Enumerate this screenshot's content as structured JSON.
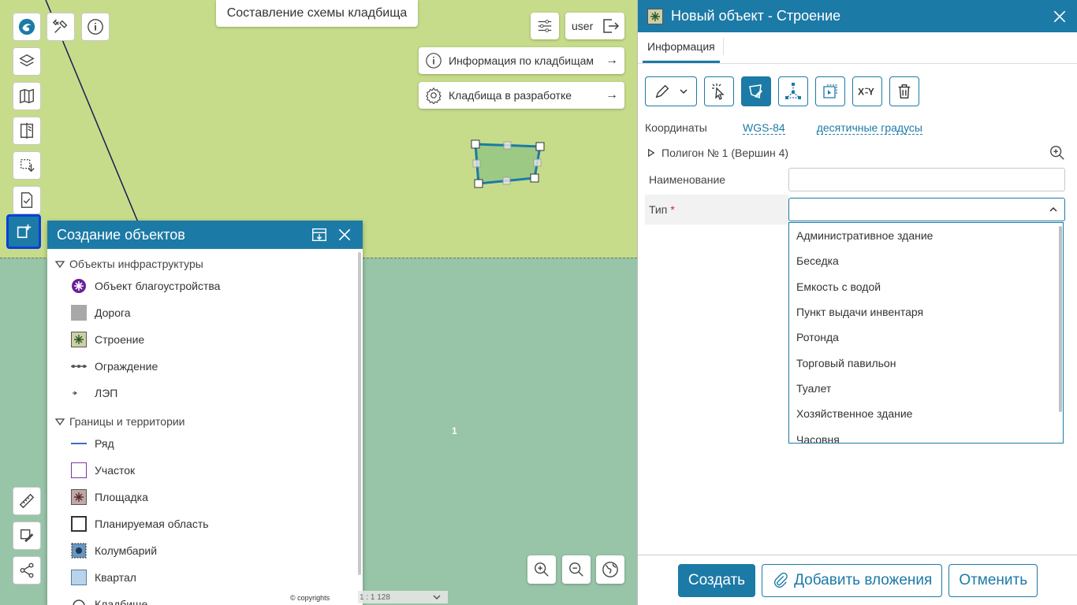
{
  "map": {
    "title": "Составление схемы кладбища",
    "polygon_label": "1",
    "user_label": "user",
    "info_buttons": [
      {
        "label": "Информация по кладбищам",
        "arrow": "→"
      },
      {
        "label": "Кладбища в разработке",
        "arrow": "→"
      }
    ],
    "copyright": "© copyrights",
    "scale": "1 : 1 128"
  },
  "create_panel": {
    "title": "Создание объектов",
    "groups": [
      {
        "label": "Объекты инфраструктуры",
        "items": [
          "Объект благоустройства",
          "Дорога",
          "Строение",
          "Ограждение",
          "ЛЭП"
        ]
      },
      {
        "label": "Границы и территории",
        "items": [
          "Ряд",
          "Участок",
          "Площадка",
          "Планируемая область",
          "Колумбарий",
          "Квартал",
          "Кладбище"
        ]
      }
    ]
  },
  "object_panel": {
    "title": "Новый объект - Строение",
    "tab": "Информация",
    "coords_label": "Координаты",
    "coord_system": "WGS-84",
    "coord_format": "десятичные градусы",
    "polygon": "Полигон № 1 (Вершин 4)",
    "name_label": "Наименование",
    "name_value": "",
    "type_label": "Тип",
    "required_mark": "*",
    "type_options": [
      "Административное здание",
      "Беседка",
      "Емкость с водой",
      "Пункт выдачи инвентаря",
      "Ротонда",
      "Торговый павильон",
      "Туалет",
      "Хозяйственное здание",
      "Часовня"
    ],
    "buttons": {
      "create": "Создать",
      "attach": "Добавить вложения",
      "cancel": "Отменить"
    }
  },
  "colors": {
    "accent": "#1c7aa6",
    "map_green": "#c6dc8a",
    "map_teal": "#98c4a8",
    "polygon_fill": "#9cc984"
  }
}
